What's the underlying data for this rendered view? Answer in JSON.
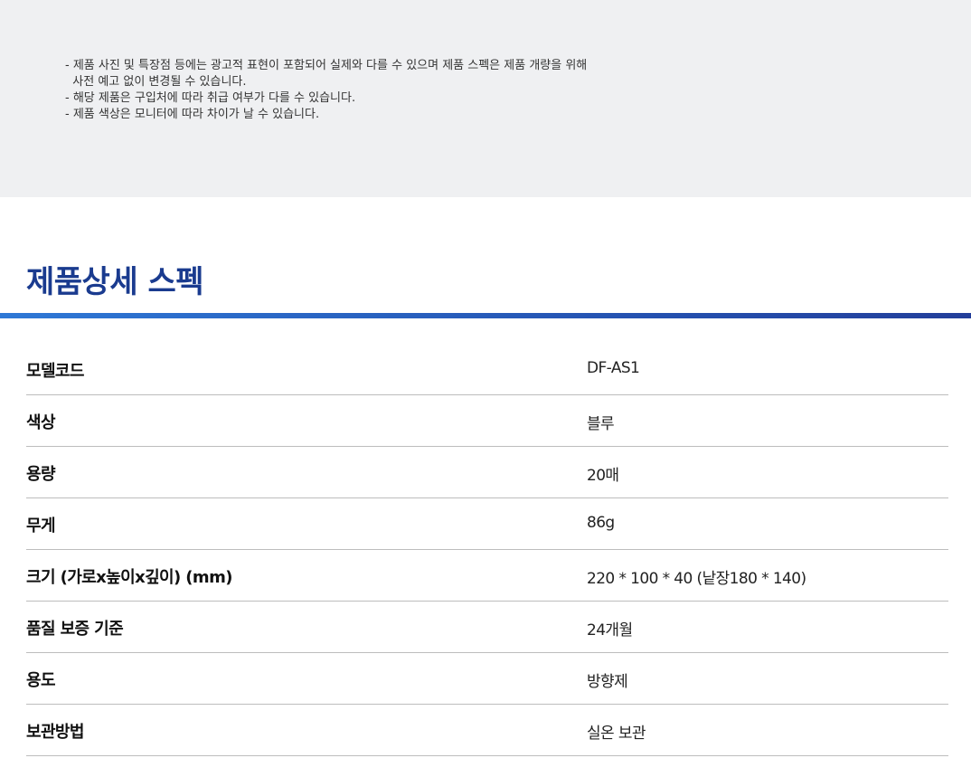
{
  "notice": {
    "lines": [
      "- 제품 사진 및 특장점 등에는 광고적 표현이 포함되어 실제와 다를 수 있으며 제품 스펙은 제품 개량을 위해",
      "  사전 예고 없이 변경될 수 있습니다.",
      "- 해당 제품은 구입처에 따라 취급 여부가 다를 수 있습니다.",
      "- 제품 색상은 모니터에 따라 차이가 날 수 있습니다."
    ]
  },
  "section": {
    "title": "제품상세 스펙"
  },
  "specs": [
    {
      "key": "모델코드",
      "value": "DF-AS1"
    },
    {
      "key": "색상",
      "value": "블루"
    },
    {
      "key": "용량",
      "value": "20매"
    },
    {
      "key": "무게",
      "value": "86g"
    },
    {
      "key": "크기 (가로x높이x깊이) (mm)",
      "value": "220 * 100 * 40 (낱장180 * 140)"
    },
    {
      "key": "품질 보증 기준",
      "value": "24개월"
    },
    {
      "key": "용도",
      "value": "방향제"
    },
    {
      "key": "보관방법",
      "value": "실온 보관"
    }
  ]
}
